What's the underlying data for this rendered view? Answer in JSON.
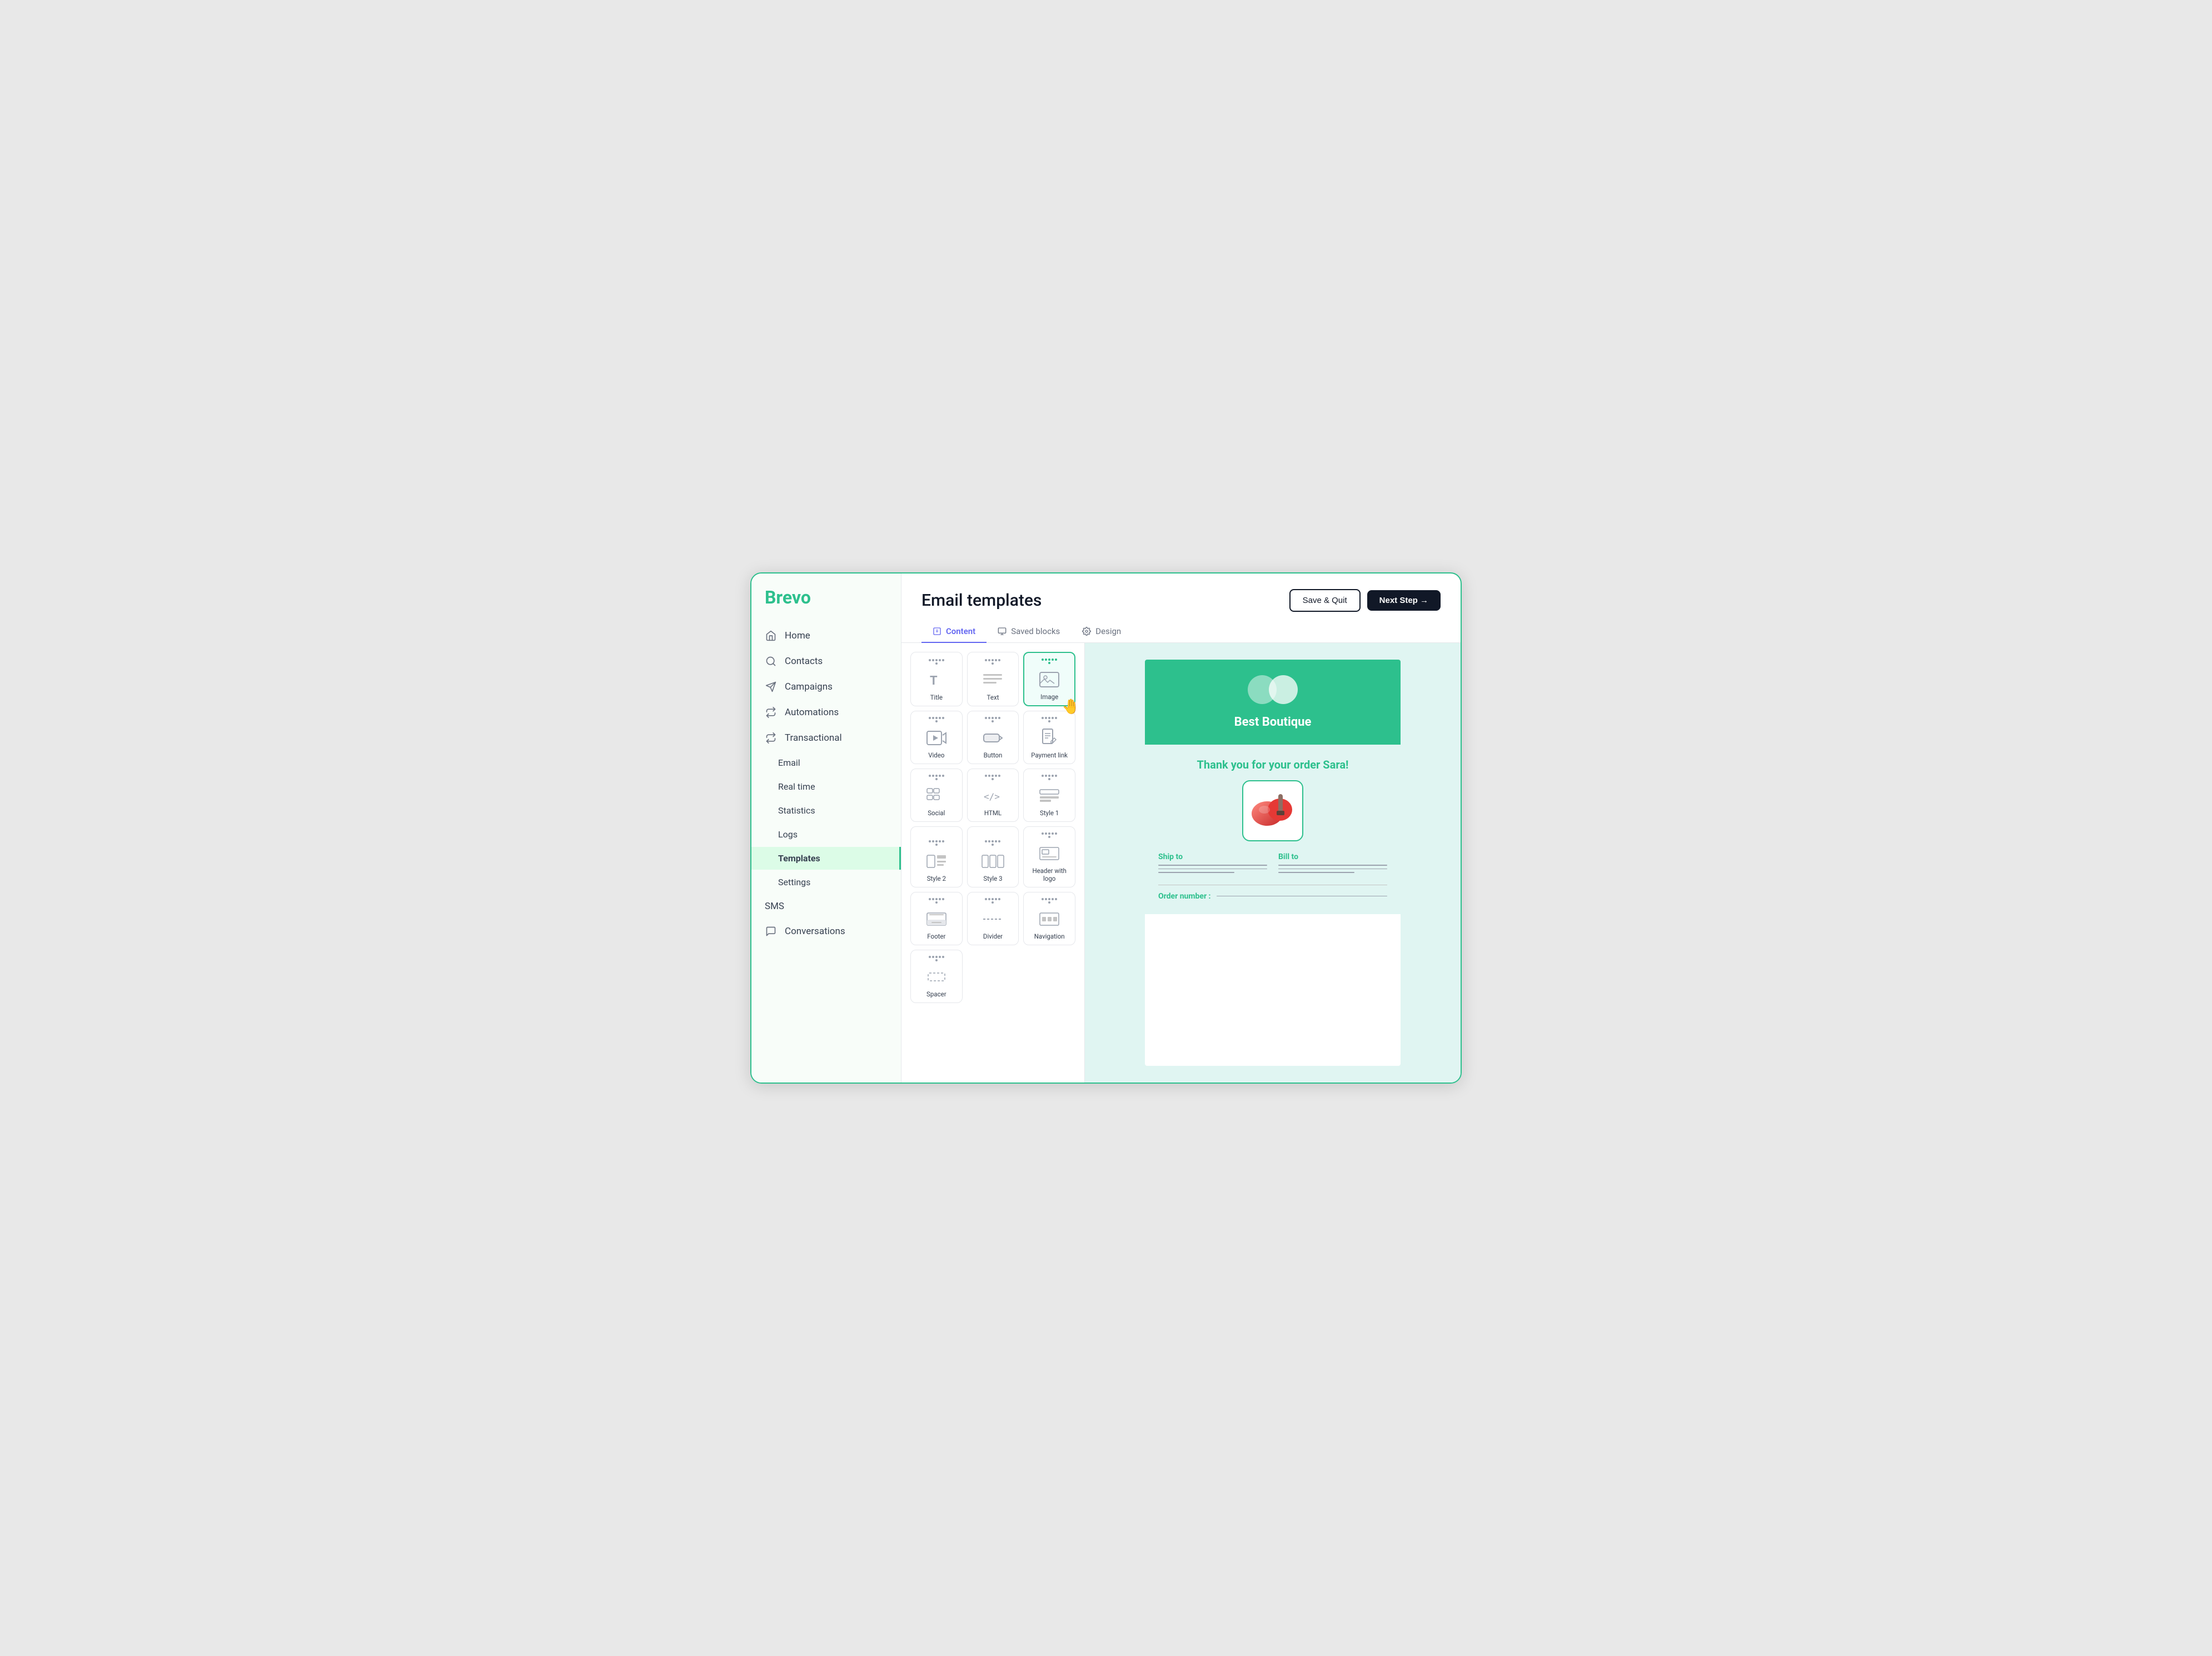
{
  "app": {
    "logo": "Brevo",
    "page_title": "Email templates",
    "save_quit_label": "Save & Quit",
    "next_step_label": "Next Step →"
  },
  "sidebar": {
    "items": [
      {
        "id": "home",
        "label": "Home",
        "icon": "home-icon",
        "active": false,
        "sub": false
      },
      {
        "id": "contacts",
        "label": "Contacts",
        "icon": "contacts-icon",
        "active": false,
        "sub": false
      },
      {
        "id": "campaigns",
        "label": "Campaigns",
        "icon": "campaigns-icon",
        "active": false,
        "sub": false
      },
      {
        "id": "automations",
        "label": "Automations",
        "icon": "automations-icon",
        "active": false,
        "sub": false
      },
      {
        "id": "transactional",
        "label": "Transactional",
        "icon": "transactional-icon",
        "active": false,
        "sub": false
      },
      {
        "id": "email",
        "label": "Email",
        "icon": "",
        "active": false,
        "sub": true
      },
      {
        "id": "realtime",
        "label": "Real time",
        "icon": "",
        "active": false,
        "sub": true
      },
      {
        "id": "statistics",
        "label": "Statistics",
        "icon": "",
        "active": false,
        "sub": true
      },
      {
        "id": "logs",
        "label": "Logs",
        "icon": "",
        "active": false,
        "sub": true
      },
      {
        "id": "templates",
        "label": "Templates",
        "icon": "",
        "active": true,
        "sub": true
      },
      {
        "id": "settings",
        "label": "Settings",
        "icon": "",
        "active": false,
        "sub": true
      },
      {
        "id": "sms",
        "label": "SMS",
        "icon": "",
        "active": false,
        "sub": false
      },
      {
        "id": "conversations",
        "label": "Conversations",
        "icon": "conversations-icon",
        "active": false,
        "sub": false
      }
    ]
  },
  "tabs": [
    {
      "id": "content",
      "label": "Content",
      "icon": "content-icon",
      "active": true
    },
    {
      "id": "saved-blocks",
      "label": "Saved blocks",
      "icon": "saved-blocks-icon",
      "active": false
    },
    {
      "id": "design",
      "label": "Design",
      "icon": "design-icon",
      "active": false
    }
  ],
  "blocks": [
    {
      "id": "title",
      "label": "Title",
      "icon": "title-icon"
    },
    {
      "id": "text",
      "label": "Text",
      "icon": "text-icon"
    },
    {
      "id": "image",
      "label": "Image",
      "icon": "image-icon",
      "selected": true
    },
    {
      "id": "video",
      "label": "Video",
      "icon": "video-icon"
    },
    {
      "id": "button",
      "label": "Button",
      "icon": "button-icon"
    },
    {
      "id": "payment-link",
      "label": "Payment link",
      "icon": "payment-link-icon"
    },
    {
      "id": "social",
      "label": "Social",
      "icon": "social-icon"
    },
    {
      "id": "html",
      "label": "HTML",
      "icon": "html-icon"
    },
    {
      "id": "style1",
      "label": "Style 1",
      "icon": "style1-icon"
    },
    {
      "id": "style2",
      "label": "Style 2",
      "icon": "style2-icon"
    },
    {
      "id": "style3",
      "label": "Style 3",
      "icon": "style3-icon"
    },
    {
      "id": "header-logo",
      "label": "Header with logo",
      "icon": "header-logo-icon"
    },
    {
      "id": "footer",
      "label": "Footer",
      "icon": "footer-icon"
    },
    {
      "id": "divider",
      "label": "Divider",
      "icon": "divider-icon"
    },
    {
      "id": "navigation",
      "label": "Navigation",
      "icon": "navigation-icon"
    },
    {
      "id": "spacer",
      "label": "Spacer",
      "icon": "spacer-icon"
    }
  ],
  "email_preview": {
    "brand_name": "Best Boutique",
    "thank_you_text": "Thank you for your order Sara!",
    "ship_to_label": "Ship to",
    "bill_to_label": "Bill to",
    "order_number_label": "Order number :"
  },
  "colors": {
    "brand_green": "#2dc08d",
    "sidebar_active_bg": "#dcfce7",
    "tab_active_color": "#6366f1"
  }
}
